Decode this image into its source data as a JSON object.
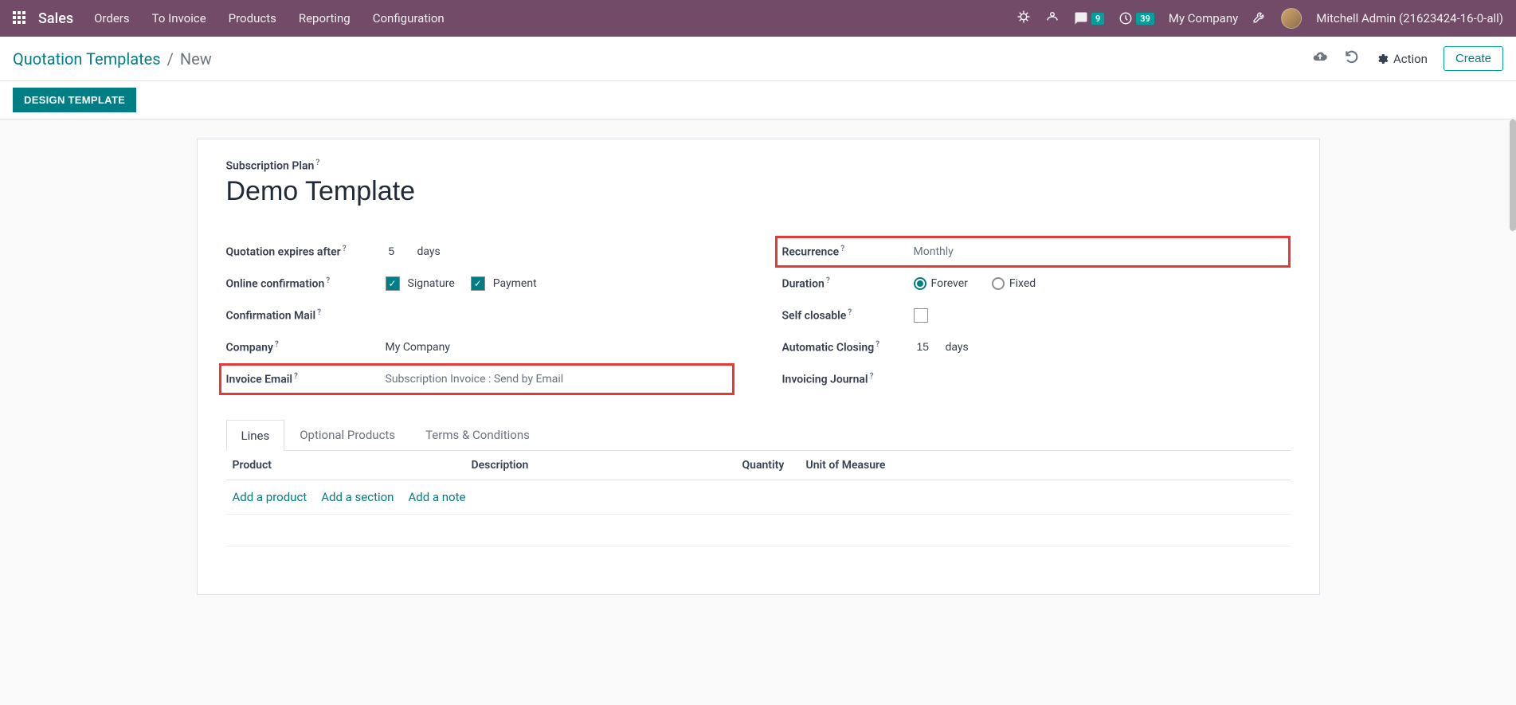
{
  "navbar": {
    "brand": "Sales",
    "menu": [
      "Orders",
      "To Invoice",
      "Products",
      "Reporting",
      "Configuration"
    ],
    "messages_badge": "9",
    "activities_badge": "39",
    "company": "My Company",
    "user": "Mitchell Admin (21623424-16-0-all)"
  },
  "breadcrumb": {
    "parent": "Quotation Templates",
    "current": "New",
    "action": "Action",
    "create": "Create"
  },
  "statusbar": {
    "design_template": "DESIGN TEMPLATE"
  },
  "form": {
    "sub_plan_label": "Subscription Plan",
    "title": "Demo Template",
    "labels": {
      "quotation_expires": "Quotation expires after",
      "online_confirmation": "Online confirmation",
      "confirmation_mail": "Confirmation Mail",
      "company": "Company",
      "invoice_email": "Invoice Email",
      "recurrence": "Recurrence",
      "duration": "Duration",
      "self_closable": "Self closable",
      "automatic_closing": "Automatic Closing",
      "invoicing_journal": "Invoicing Journal"
    },
    "values": {
      "expires_value": "5",
      "expires_unit": "days",
      "signature": "Signature",
      "payment": "Payment",
      "company": "My Company",
      "invoice_email": "Subscription Invoice : Send by Email",
      "recurrence": "Monthly",
      "forever": "Forever",
      "fixed": "Fixed",
      "auto_close_value": "15",
      "auto_close_unit": "days"
    }
  },
  "tabs": [
    "Lines",
    "Optional Products",
    "Terms & Conditions"
  ],
  "table": {
    "headers": {
      "product": "Product",
      "description": "Description",
      "quantity": "Quantity",
      "uom": "Unit of Measure"
    },
    "actions": {
      "add_product": "Add a product",
      "add_section": "Add a section",
      "add_note": "Add a note"
    }
  }
}
